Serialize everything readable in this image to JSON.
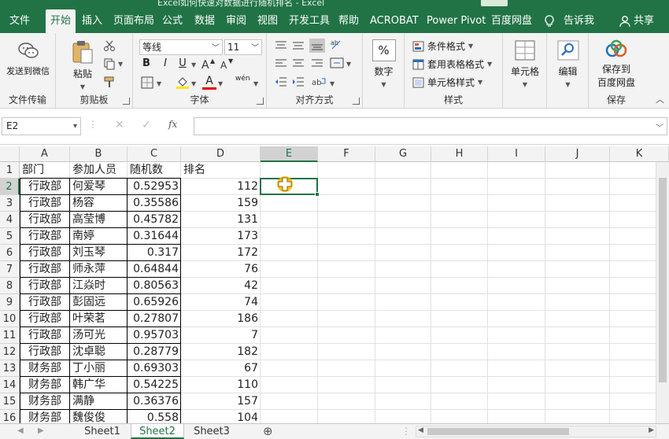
{
  "window": {
    "title": "Excel如何快速对数据进行随机排名 - Excel"
  },
  "tabs": [
    {
      "label": "文件"
    },
    {
      "label": "开始"
    },
    {
      "label": "插入"
    },
    {
      "label": "页面布局"
    },
    {
      "label": "公式"
    },
    {
      "label": "数据"
    },
    {
      "label": "审阅"
    },
    {
      "label": "视图"
    },
    {
      "label": "开发工具"
    },
    {
      "label": "帮助"
    },
    {
      "label": "ACROBAT"
    },
    {
      "label": "Power Pivot"
    },
    {
      "label": "百度网盘"
    },
    {
      "label": "告诉我"
    },
    {
      "label": "共享"
    }
  ],
  "ribbon": {
    "send_wechat": "发送到微信",
    "file_transfer": "文件传输",
    "paste": "粘贴",
    "clipboard": "剪贴板",
    "font_name": "等线",
    "font_size": "11",
    "bold": "B",
    "italic": "I",
    "underline": "U",
    "font_color_letter": "A",
    "phonetic": "wén",
    "font_group": "字体",
    "align_group": "对齐方式",
    "number": "数字",
    "percent": "%",
    "cond_format": "条件格式",
    "table_format": "套用表格格式",
    "cell_style": "单元格样式",
    "style_group": "样式",
    "cells": "单元格",
    "edit": "编辑",
    "save_baidu_1": "保存到",
    "save_baidu_2": "百度网盘",
    "save_group": "保存"
  },
  "formula_bar": {
    "name_box": "E2",
    "formula": "",
    "fx": "fx"
  },
  "columns": [
    "A",
    "B",
    "C",
    "D",
    "E",
    "F",
    "G",
    "H",
    "I",
    "J",
    "K"
  ],
  "selected_cell": "E2",
  "headers": [
    "部门",
    "参加人员",
    "随机数",
    "排名"
  ],
  "rows": [
    {
      "n": "2",
      "dept": "行政部",
      "name": "何爱琴",
      "rand": "0.52953",
      "rank": "112"
    },
    {
      "n": "3",
      "dept": "行政部",
      "name": "杨容",
      "rand": "0.35586",
      "rank": "159"
    },
    {
      "n": "4",
      "dept": "行政部",
      "name": "高莹博",
      "rand": "0.45782",
      "rank": "131"
    },
    {
      "n": "5",
      "dept": "行政部",
      "name": "南婷",
      "rand": "0.31644",
      "rank": "173"
    },
    {
      "n": "6",
      "dept": "行政部",
      "name": "刘玉琴",
      "rand": "0.317",
      "rank": "172"
    },
    {
      "n": "7",
      "dept": "行政部",
      "name": "师永萍",
      "rand": "0.64844",
      "rank": "76"
    },
    {
      "n": "8",
      "dept": "行政部",
      "name": "江焱时",
      "rand": "0.80563",
      "rank": "42"
    },
    {
      "n": "9",
      "dept": "行政部",
      "name": "彭固远",
      "rand": "0.65926",
      "rank": "74"
    },
    {
      "n": "10",
      "dept": "行政部",
      "name": "叶荣茗",
      "rand": "0.27807",
      "rank": "186"
    },
    {
      "n": "11",
      "dept": "行政部",
      "name": "汤可光",
      "rand": "0.95703",
      "rank": "7"
    },
    {
      "n": "12",
      "dept": "行政部",
      "name": "沈卓聪",
      "rand": "0.28779",
      "rank": "182"
    },
    {
      "n": "13",
      "dept": "财务部",
      "name": "丁小丽",
      "rand": "0.69303",
      "rank": "67"
    },
    {
      "n": "14",
      "dept": "财务部",
      "name": "韩广华",
      "rand": "0.54225",
      "rank": "110"
    },
    {
      "n": "15",
      "dept": "财务部",
      "name": "满静",
      "rand": "0.36376",
      "rank": "157"
    },
    {
      "n": "16",
      "dept": "财务部",
      "name": "魏俊俊",
      "rand": "0.558",
      "rank": "104"
    }
  ],
  "sheets": [
    {
      "label": "Sheet1"
    },
    {
      "label": "Sheet2"
    },
    {
      "label": "Sheet3"
    }
  ],
  "active_sheet": "Sheet2",
  "colors": {
    "accent": "#217346",
    "ribbon_bg": "#f3f3f3",
    "cursor": "#f5b400"
  }
}
